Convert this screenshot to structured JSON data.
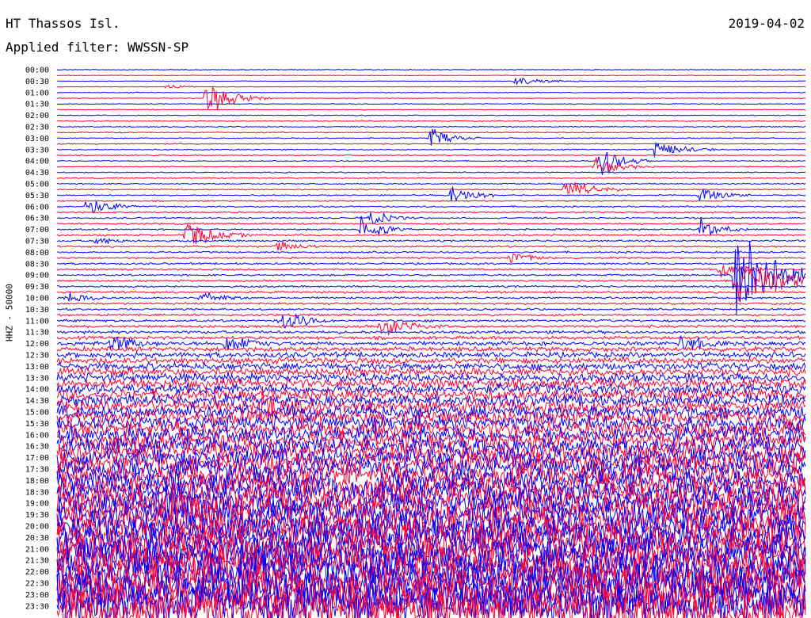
{
  "header": {
    "station": "HT Thassos Isl.",
    "filter": "Applied filter: WWSSN-SP",
    "date": "2019-04-02"
  },
  "chart_data": {
    "type": "line",
    "title": "HT Thassos Isl.",
    "subtitle": "Applied filter: WWSSN-SP",
    "date": "2019-04-02",
    "ylabel": "HHZ - 50000",
    "xlabel": "",
    "time_labels": [
      "00:00",
      "00:30",
      "01:00",
      "01:30",
      "02:00",
      "02:30",
      "03:00",
      "03:30",
      "04:00",
      "04:30",
      "05:00",
      "05:30",
      "06:00",
      "06:30",
      "07:00",
      "07:30",
      "08:00",
      "08:30",
      "09:00",
      "09:30",
      "10:00",
      "10:30",
      "11:00",
      "11:30",
      "12:00",
      "12:30",
      "13:00",
      "13:30",
      "14:00",
      "14:30",
      "15:00",
      "15:30",
      "16:00",
      "16:30",
      "17:00",
      "17:30",
      "18:00",
      "18:30",
      "19:00",
      "19:30",
      "20:00",
      "20:30",
      "21:00",
      "21:30",
      "22:00",
      "22:30",
      "23:00",
      "23:30"
    ],
    "series_colors": [
      "#0000ff",
      "#ff0033"
    ],
    "trace_minutes": 15,
    "noise_by_trace": [
      0.35,
      0.35,
      0.35,
      0.35,
      0.4,
      0.4,
      0.45,
      0.45,
      0.5,
      0.5,
      0.55,
      0.6,
      0.6,
      0.6,
      0.6,
      0.6,
      0.6,
      0.6,
      0.6,
      0.6,
      0.65,
      0.65,
      0.7,
      0.75,
      0.8,
      0.85,
      0.85,
      0.9,
      0.9,
      0.9,
      0.95,
      0.95,
      0.95,
      1.0,
      1.0,
      1.0,
      1.0,
      1.0,
      1.05,
      1.05,
      1.05,
      1.1,
      1.1,
      1.2,
      1.3,
      1.4,
      1.6,
      1.8,
      2.2,
      2.6,
      3.0,
      3.4,
      3.8,
      4.3,
      4.8,
      5.2,
      5.6,
      6.0,
      6.4,
      6.8,
      7.2,
      7.6,
      8.0,
      8.4,
      8.8,
      9.2,
      9.6,
      10.0,
      10.4,
      10.8,
      11.2,
      11.6,
      12.0,
      12.4,
      12.8,
      13.2,
      13.6,
      14.0,
      14.4,
      14.8,
      15.2,
      15.6,
      16.0,
      16.4,
      16.8,
      17.2,
      17.6,
      18.0,
      18.4,
      18.8,
      19.2,
      19.6,
      20.0,
      20.4,
      20.8,
      21.2
    ],
    "events": [
      {
        "trace": 2,
        "minute": 9.2,
        "amp": 6,
        "dur": 1.4
      },
      {
        "trace": 3,
        "minute": 2.2,
        "amp": 3,
        "dur": 0.9
      },
      {
        "trace": 5,
        "minute": 3.0,
        "amp": 26,
        "dur": 1.3
      },
      {
        "trace": 12,
        "minute": 7.5,
        "amp": 14,
        "dur": 1.0
      },
      {
        "trace": 14,
        "minute": 12.0,
        "amp": 16,
        "dur": 1.2
      },
      {
        "trace": 16,
        "minute": 10.9,
        "amp": 26,
        "dur": 1.0
      },
      {
        "trace": 17,
        "minute": 10.8,
        "amp": 12,
        "dur": 1.2
      },
      {
        "trace": 21,
        "minute": 10.2,
        "amp": 20,
        "dur": 1.2
      },
      {
        "trace": 22,
        "minute": 7.9,
        "amp": 18,
        "dur": 1.0
      },
      {
        "trace": 22,
        "minute": 12.9,
        "amp": 14,
        "dur": 1.0
      },
      {
        "trace": 24,
        "minute": 0.6,
        "amp": 16,
        "dur": 1.1
      },
      {
        "trace": 26,
        "minute": 6.3,
        "amp": 12,
        "dur": 0.9
      },
      {
        "trace": 28,
        "minute": 6.1,
        "amp": 20,
        "dur": 1.0
      },
      {
        "trace": 28,
        "minute": 12.9,
        "amp": 16,
        "dur": 1.0
      },
      {
        "trace": 29,
        "minute": 2.6,
        "amp": 22,
        "dur": 1.3
      },
      {
        "trace": 30,
        "minute": 0.8,
        "amp": 6,
        "dur": 1.0
      },
      {
        "trace": 31,
        "minute": 4.4,
        "amp": 8,
        "dur": 1.0
      },
      {
        "trace": 33,
        "minute": 9.1,
        "amp": 10,
        "dur": 1.0
      },
      {
        "trace": 35,
        "minute": 13.3,
        "amp": 14,
        "dur": 1.0
      },
      {
        "trace": 40,
        "minute": 0.2,
        "amp": 10,
        "dur": 1.0
      },
      {
        "trace": 40,
        "minute": 2.9,
        "amp": 9,
        "dur": 1.0
      },
      {
        "trace": 44,
        "minute": 4.5,
        "amp": 22,
        "dur": 1.0
      },
      {
        "trace": 45,
        "minute": 6.5,
        "amp": 18,
        "dur": 1.2
      },
      {
        "trace": 48,
        "minute": 1.1,
        "amp": 14,
        "dur": 1.0
      },
      {
        "trace": 48,
        "minute": 3.4,
        "amp": 14,
        "dur": 1.0
      },
      {
        "trace": 48,
        "minute": 12.5,
        "amp": 18,
        "dur": 1.0
      },
      {
        "trace": 59,
        "minute": 4.1,
        "amp": 22,
        "dur": 1.2
      },
      {
        "trace": 37,
        "minute": 13.6,
        "amp": 30,
        "dur": 3.0
      },
      {
        "trace": 36,
        "minute": 13.6,
        "amp": 70,
        "dur": 2.0
      },
      {
        "trace": 77,
        "minute": 2.1,
        "amp": 28,
        "dur": 1.5
      },
      {
        "trace": 79,
        "minute": 2.3,
        "amp": 40,
        "dur": 2.0
      },
      {
        "trace": 76,
        "minute": 2.1,
        "amp": 18,
        "dur": 1.0
      }
    ],
    "gap": {
      "trace": 72,
      "from_minute": 5.5,
      "to_minute": 6.4
    }
  }
}
